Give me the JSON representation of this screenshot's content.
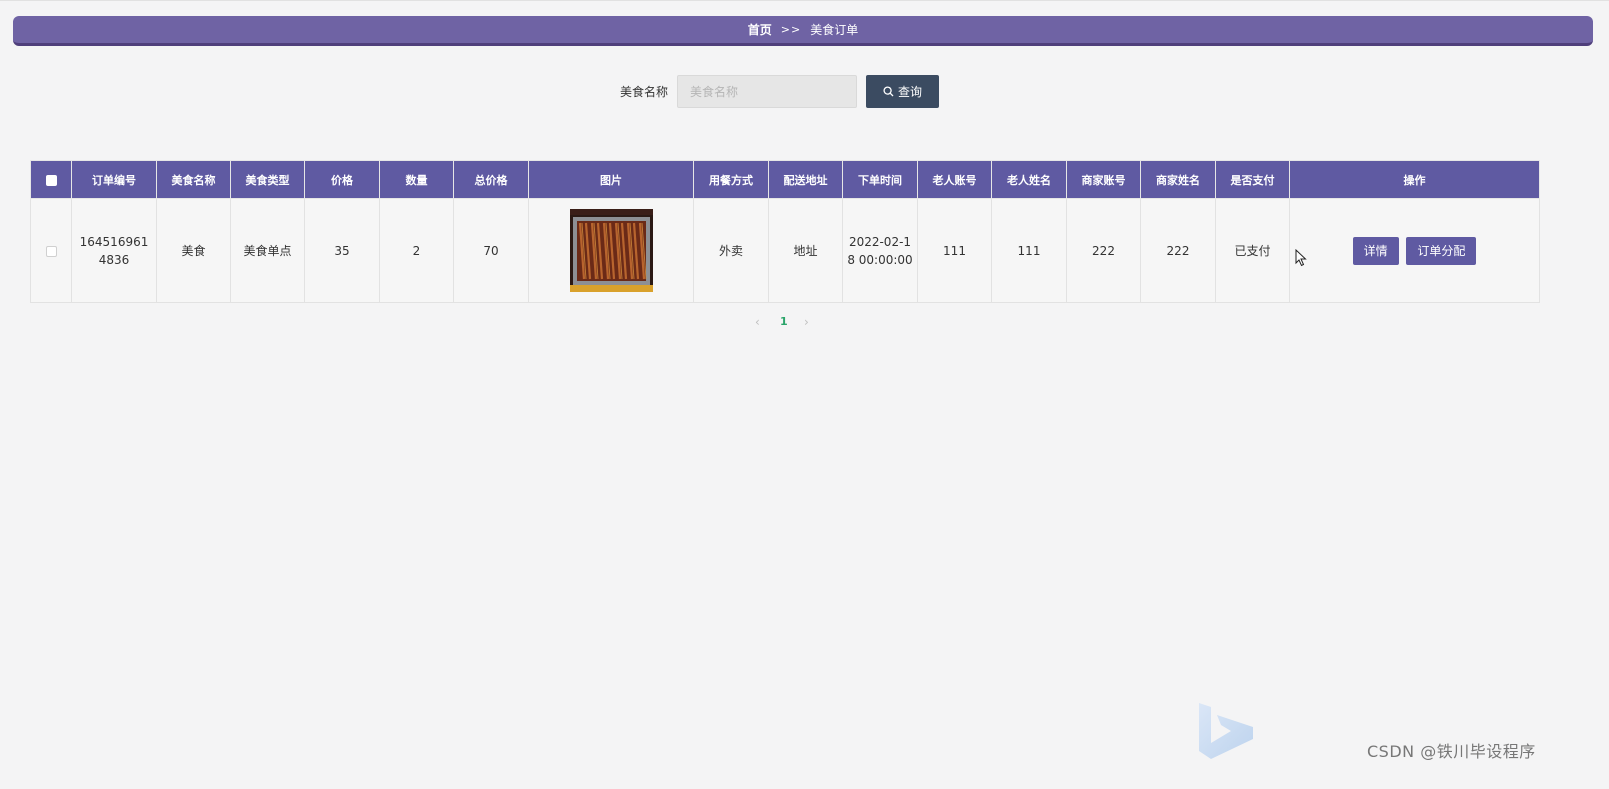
{
  "breadcrumb": {
    "home": "首页",
    "separator": ">>",
    "current": "美食订单"
  },
  "search": {
    "label": "美食名称",
    "placeholder": "美食名称",
    "value": "",
    "button_label": "查询"
  },
  "table": {
    "columns": [
      "订单编号",
      "美食名称",
      "美食类型",
      "价格",
      "数量",
      "总价格",
      "图片",
      "用餐方式",
      "配送地址",
      "下单时间",
      "老人账号",
      "老人姓名",
      "商家账号",
      "商家姓名",
      "是否支付",
      "操作"
    ],
    "rows": [
      {
        "order_no": "1645169614836",
        "food_name": "美食",
        "food_type": "美食单点",
        "price": "35",
        "quantity": "2",
        "total": "70",
        "dining_mode": "外卖",
        "address": "地址",
        "order_time": "2022-02-18 00:00:00",
        "elder_account": "111",
        "elder_name": "111",
        "merchant_account": "222",
        "merchant_name": "222",
        "paid": "已支付",
        "detail_label": "详情",
        "assign_label": "订单分配"
      }
    ]
  },
  "pagination": {
    "prev": "‹",
    "current_page": "1",
    "next": "›"
  },
  "watermark": "CSDN @铁川毕设程序",
  "colors": {
    "accent": "#5f5aa2",
    "breadcrumb_bg": "#6f63a4",
    "search_button": "#3b4b61",
    "page_active": "#2aa46a",
    "background": "#f4f4f5"
  }
}
